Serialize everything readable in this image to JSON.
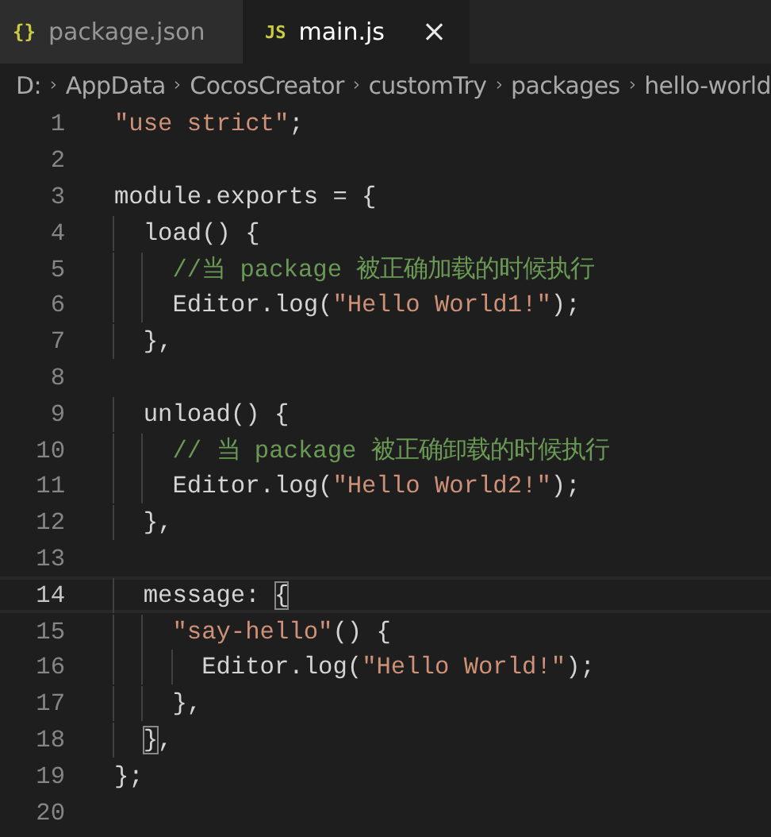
{
  "tabs": [
    {
      "icon": "{}",
      "kind": "json",
      "label": "package.json",
      "selected": false
    },
    {
      "icon": "JS",
      "kind": "js",
      "label": "main.js",
      "selected": true
    }
  ],
  "breadcrumb": [
    "D:",
    "AppData",
    "CocosCreator",
    "customTry",
    "packages",
    "hello-world"
  ],
  "lines": [
    {
      "number": "1",
      "current": false,
      "tokens": [
        {
          "text": "\"use strict\"",
          "kind": "string"
        },
        {
          "text": ";",
          "kind": "plain"
        }
      ]
    },
    {
      "number": "2",
      "current": false
    },
    {
      "number": "3",
      "current": false,
      "tokens": [
        {
          "text": "module.exports = {",
          "kind": "plain"
        }
      ]
    },
    {
      "number": "4",
      "current": false,
      "tokens": [
        {
          "text": "  load() {",
          "kind": "plain"
        }
      ]
    },
    {
      "number": "5",
      "current": false,
      "tokens": [
        {
          "text": "    //当 package 被正确加载的时候执行",
          "kind": "comment"
        }
      ]
    },
    {
      "number": "6",
      "current": false,
      "tokens": [
        {
          "text": "    Editor.log(",
          "kind": "plain"
        },
        {
          "text": "\"Hello World1!\"",
          "kind": "string"
        },
        {
          "text": ");",
          "kind": "plain"
        }
      ]
    },
    {
      "number": "7",
      "current": false,
      "tokens": [
        {
          "text": "  },",
          "kind": "plain"
        }
      ]
    },
    {
      "number": "8",
      "current": false
    },
    {
      "number": "9",
      "current": false,
      "tokens": [
        {
          "text": "  unload() {",
          "kind": "plain"
        }
      ]
    },
    {
      "number": "10",
      "current": false,
      "tokens": [
        {
          "text": "    // 当 package 被正确卸载的时候执行",
          "kind": "comment"
        }
      ]
    },
    {
      "number": "11",
      "current": false,
      "tokens": [
        {
          "text": "    Editor.log(",
          "kind": "plain"
        },
        {
          "text": "\"Hello World2!\"",
          "kind": "string"
        },
        {
          "text": ");",
          "kind": "plain"
        }
      ]
    },
    {
      "number": "12",
      "current": false,
      "tokens": [
        {
          "text": "  },",
          "kind": "plain"
        }
      ]
    },
    {
      "number": "13",
      "current": false
    },
    {
      "number": "14",
      "current": true,
      "tokens": [
        {
          "text": "  message: ",
          "kind": "plain"
        },
        {
          "text": "{",
          "kind": "bracket-match"
        }
      ]
    },
    {
      "number": "15",
      "current": false,
      "tokens": [
        {
          "text": "    \"say-hello\"",
          "kind": "string"
        },
        {
          "text": "() {",
          "kind": "plain"
        }
      ]
    },
    {
      "number": "16",
      "current": false,
      "tokens": [
        {
          "text": "      Editor.log(",
          "kind": "plain"
        },
        {
          "text": "\"Hello World!\"",
          "kind": "string"
        },
        {
          "text": ");",
          "kind": "plain"
        }
      ]
    },
    {
      "number": "17",
      "current": false,
      "tokens": [
        {
          "text": "    },",
          "kind": "plain"
        }
      ]
    },
    {
      "number": "18",
      "current": false,
      "tokens": [
        {
          "text": "  }",
          "kind": "bracket-match"
        },
        {
          "text": ",",
          "kind": "plain"
        }
      ]
    },
    {
      "number": "19",
      "current": false,
      "tokens": [
        {
          "text": "};",
          "kind": "plain"
        }
      ]
    },
    {
      "number": "20",
      "current": false
    }
  ]
}
